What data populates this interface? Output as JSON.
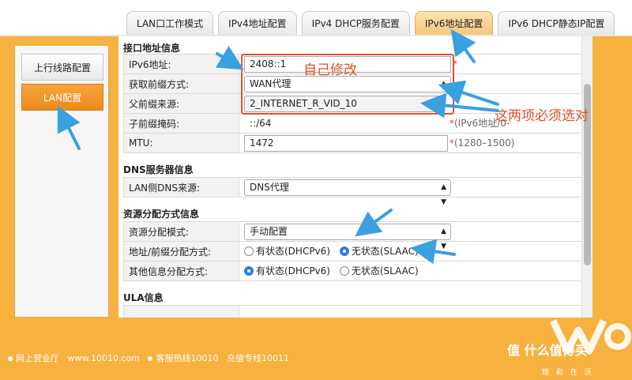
{
  "tabs": [
    {
      "label": "LAN口工作模式",
      "active": false
    },
    {
      "label": "IPv4地址配置",
      "active": false
    },
    {
      "label": "IPv4 DHCP服务配置",
      "active": false
    },
    {
      "label": "IPv6地址配置",
      "active": true
    },
    {
      "label": "IPv6 DHCP静态IP配置",
      "active": false
    }
  ],
  "sidebar": {
    "items": [
      {
        "label": "上行线路配置",
        "active": false
      },
      {
        "label": "LAN配置",
        "active": true
      }
    ]
  },
  "sections": {
    "interface": {
      "title": "接口地址信息",
      "rows": {
        "ipv6_address": {
          "label": "IPv6地址:",
          "value": "2408::1",
          "required": "*"
        },
        "prefix_mode": {
          "label": "获取前缀方式:",
          "value": "WAN代理"
        },
        "parent_prefix": {
          "label": "父前缀来源:",
          "value": "2_INTERNET_R_VID_10"
        },
        "sub_prefix_mask": {
          "label": "子前缀掩码:",
          "value": "::/64",
          "required": "*",
          "hint": "(IPv6地址/0-"
        },
        "mtu": {
          "label": "MTU:",
          "value": "1472",
          "required": "*",
          "hint": "(1280–1500)"
        }
      }
    },
    "dns": {
      "title": "DNS服务器信息",
      "rows": {
        "lan_dns_source": {
          "label": "LAN侧DNS来源:",
          "value": "DNS代理"
        }
      }
    },
    "resource": {
      "title": "资源分配方式信息",
      "rows": {
        "alloc_mode": {
          "label": "资源分配模式:",
          "value": "手动配置"
        },
        "addr_prefix_mode": {
          "label": "地址/前缀分配方式:",
          "option_a": "有状态(DHCPv6)",
          "option_b": "无状态(SLAAC)",
          "selected": "option_b"
        },
        "other_info_mode": {
          "label": "其他信息分配方式:",
          "option_a": "有状态(DHCPv6)",
          "option_b": "无状态(SLAAC)",
          "selected": "option_a"
        }
      }
    },
    "ula": {
      "title": "ULA信息"
    }
  },
  "annotations": {
    "self_modify": "自己修改",
    "must_select": "这两项必须选对"
  },
  "footer": {
    "item1": "网上营业厅",
    "url": "www.10010.com",
    "item2": "客服热线10010",
    "item3": "充值专线10011",
    "brand": "值 什么值得买",
    "brand_sub": "精 彩 在 沃"
  },
  "colors": {
    "frame_orange": "#f7b13f",
    "active_tab": "#f4c77a",
    "annotation_red": "#e2502a",
    "arrow_blue": "#3aa0e0"
  }
}
